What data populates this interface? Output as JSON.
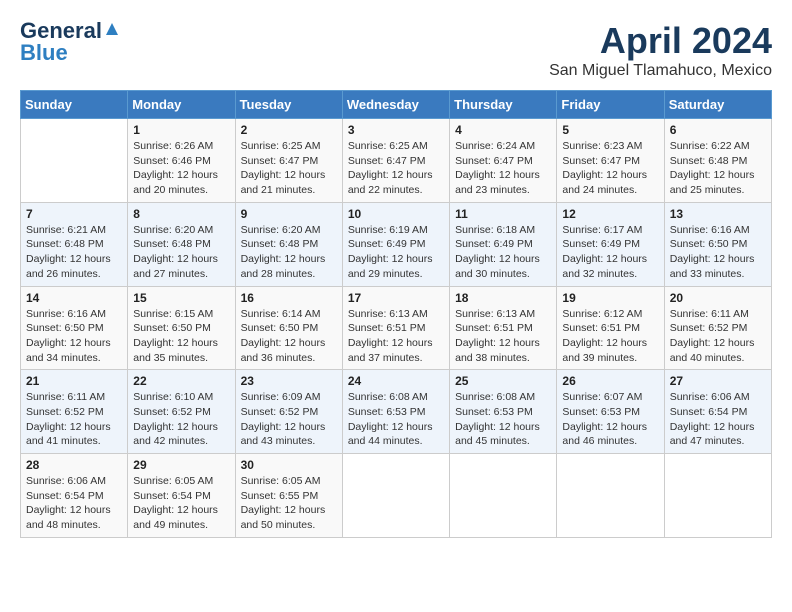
{
  "header": {
    "logo_general": "General",
    "logo_blue": "Blue",
    "month_year": "April 2024",
    "location": "San Miguel Tlamahuco, Mexico"
  },
  "weekdays": [
    "Sunday",
    "Monday",
    "Tuesday",
    "Wednesday",
    "Thursday",
    "Friday",
    "Saturday"
  ],
  "weeks": [
    [
      {
        "day": "",
        "info": ""
      },
      {
        "day": "1",
        "info": "Sunrise: 6:26 AM\nSunset: 6:46 PM\nDaylight: 12 hours\nand 20 minutes."
      },
      {
        "day": "2",
        "info": "Sunrise: 6:25 AM\nSunset: 6:47 PM\nDaylight: 12 hours\nand 21 minutes."
      },
      {
        "day": "3",
        "info": "Sunrise: 6:25 AM\nSunset: 6:47 PM\nDaylight: 12 hours\nand 22 minutes."
      },
      {
        "day": "4",
        "info": "Sunrise: 6:24 AM\nSunset: 6:47 PM\nDaylight: 12 hours\nand 23 minutes."
      },
      {
        "day": "5",
        "info": "Sunrise: 6:23 AM\nSunset: 6:47 PM\nDaylight: 12 hours\nand 24 minutes."
      },
      {
        "day": "6",
        "info": "Sunrise: 6:22 AM\nSunset: 6:48 PM\nDaylight: 12 hours\nand 25 minutes."
      }
    ],
    [
      {
        "day": "7",
        "info": "Sunrise: 6:21 AM\nSunset: 6:48 PM\nDaylight: 12 hours\nand 26 minutes."
      },
      {
        "day": "8",
        "info": "Sunrise: 6:20 AM\nSunset: 6:48 PM\nDaylight: 12 hours\nand 27 minutes."
      },
      {
        "day": "9",
        "info": "Sunrise: 6:20 AM\nSunset: 6:48 PM\nDaylight: 12 hours\nand 28 minutes."
      },
      {
        "day": "10",
        "info": "Sunrise: 6:19 AM\nSunset: 6:49 PM\nDaylight: 12 hours\nand 29 minutes."
      },
      {
        "day": "11",
        "info": "Sunrise: 6:18 AM\nSunset: 6:49 PM\nDaylight: 12 hours\nand 30 minutes."
      },
      {
        "day": "12",
        "info": "Sunrise: 6:17 AM\nSunset: 6:49 PM\nDaylight: 12 hours\nand 32 minutes."
      },
      {
        "day": "13",
        "info": "Sunrise: 6:16 AM\nSunset: 6:50 PM\nDaylight: 12 hours\nand 33 minutes."
      }
    ],
    [
      {
        "day": "14",
        "info": "Sunrise: 6:16 AM\nSunset: 6:50 PM\nDaylight: 12 hours\nand 34 minutes."
      },
      {
        "day": "15",
        "info": "Sunrise: 6:15 AM\nSunset: 6:50 PM\nDaylight: 12 hours\nand 35 minutes."
      },
      {
        "day": "16",
        "info": "Sunrise: 6:14 AM\nSunset: 6:50 PM\nDaylight: 12 hours\nand 36 minutes."
      },
      {
        "day": "17",
        "info": "Sunrise: 6:13 AM\nSunset: 6:51 PM\nDaylight: 12 hours\nand 37 minutes."
      },
      {
        "day": "18",
        "info": "Sunrise: 6:13 AM\nSunset: 6:51 PM\nDaylight: 12 hours\nand 38 minutes."
      },
      {
        "day": "19",
        "info": "Sunrise: 6:12 AM\nSunset: 6:51 PM\nDaylight: 12 hours\nand 39 minutes."
      },
      {
        "day": "20",
        "info": "Sunrise: 6:11 AM\nSunset: 6:52 PM\nDaylight: 12 hours\nand 40 minutes."
      }
    ],
    [
      {
        "day": "21",
        "info": "Sunrise: 6:11 AM\nSunset: 6:52 PM\nDaylight: 12 hours\nand 41 minutes."
      },
      {
        "day": "22",
        "info": "Sunrise: 6:10 AM\nSunset: 6:52 PM\nDaylight: 12 hours\nand 42 minutes."
      },
      {
        "day": "23",
        "info": "Sunrise: 6:09 AM\nSunset: 6:52 PM\nDaylight: 12 hours\nand 43 minutes."
      },
      {
        "day": "24",
        "info": "Sunrise: 6:08 AM\nSunset: 6:53 PM\nDaylight: 12 hours\nand 44 minutes."
      },
      {
        "day": "25",
        "info": "Sunrise: 6:08 AM\nSunset: 6:53 PM\nDaylight: 12 hours\nand 45 minutes."
      },
      {
        "day": "26",
        "info": "Sunrise: 6:07 AM\nSunset: 6:53 PM\nDaylight: 12 hours\nand 46 minutes."
      },
      {
        "day": "27",
        "info": "Sunrise: 6:06 AM\nSunset: 6:54 PM\nDaylight: 12 hours\nand 47 minutes."
      }
    ],
    [
      {
        "day": "28",
        "info": "Sunrise: 6:06 AM\nSunset: 6:54 PM\nDaylight: 12 hours\nand 48 minutes."
      },
      {
        "day": "29",
        "info": "Sunrise: 6:05 AM\nSunset: 6:54 PM\nDaylight: 12 hours\nand 49 minutes."
      },
      {
        "day": "30",
        "info": "Sunrise: 6:05 AM\nSunset: 6:55 PM\nDaylight: 12 hours\nand 50 minutes."
      },
      {
        "day": "",
        "info": ""
      },
      {
        "day": "",
        "info": ""
      },
      {
        "day": "",
        "info": ""
      },
      {
        "day": "",
        "info": ""
      }
    ]
  ]
}
